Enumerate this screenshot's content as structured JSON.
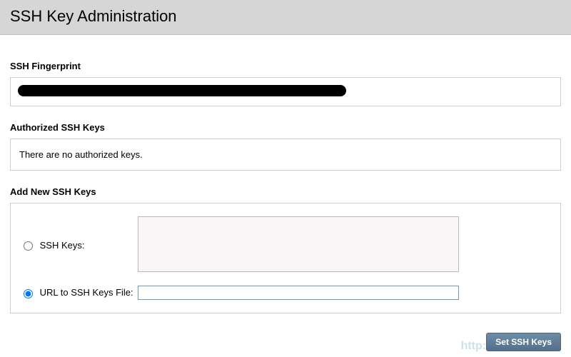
{
  "header": {
    "title": "SSH Key Administration"
  },
  "sections": {
    "fingerprint": {
      "label": "SSH Fingerprint",
      "value_redacted": true
    },
    "authorized": {
      "label": "Authorized SSH Keys",
      "empty_message": "There are no authorized keys."
    },
    "addnew": {
      "label": "Add New SSH Keys",
      "option_sshkeys": {
        "label": "SSH Keys:",
        "selected": false,
        "textarea_value": ""
      },
      "option_url": {
        "label": "URL to SSH Keys File:",
        "selected": true,
        "input_value": ""
      }
    }
  },
  "buttons": {
    "set": "Set SSH Keys"
  },
  "watermark": "http://"
}
